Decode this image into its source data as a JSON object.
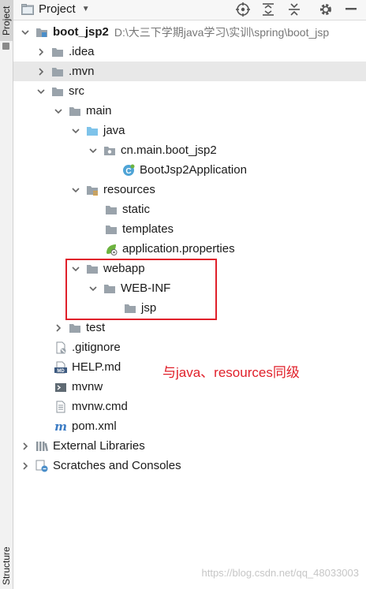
{
  "side_tabs": {
    "project": "Project",
    "structure": "Structure"
  },
  "header": {
    "title": "Project"
  },
  "tree": {
    "root": {
      "name": "boot_jsp2",
      "path": "D:\\大三下学期java学习\\实训\\spring\\boot_jsp"
    },
    "idea": ".idea",
    "mvn": ".mvn",
    "src": "src",
    "main": "main",
    "java": "java",
    "package": "cn.main.boot_jsp2",
    "app_class": "BootJsp2Application",
    "resources": "resources",
    "static": "static",
    "templates": "templates",
    "app_props": "application.properties",
    "webapp": "webapp",
    "webinf": "WEB-INF",
    "jsp": "jsp",
    "test": "test",
    "gitignore": ".gitignore",
    "help_md": "HELP.md",
    "mvnw": "mvnw",
    "mvnw_cmd": "mvnw.cmd",
    "pom": "pom.xml",
    "ext_libs": "External Libraries",
    "scratches": "Scratches and Consoles"
  },
  "annotation": "与java、resources同级",
  "watermark": "https://blog.csdn.net/qq_48033003",
  "colors": {
    "annotation_red": "#e0202a",
    "folder_gray": "#9aa3ab",
    "source_folder_blue": "#7ec3ea"
  }
}
